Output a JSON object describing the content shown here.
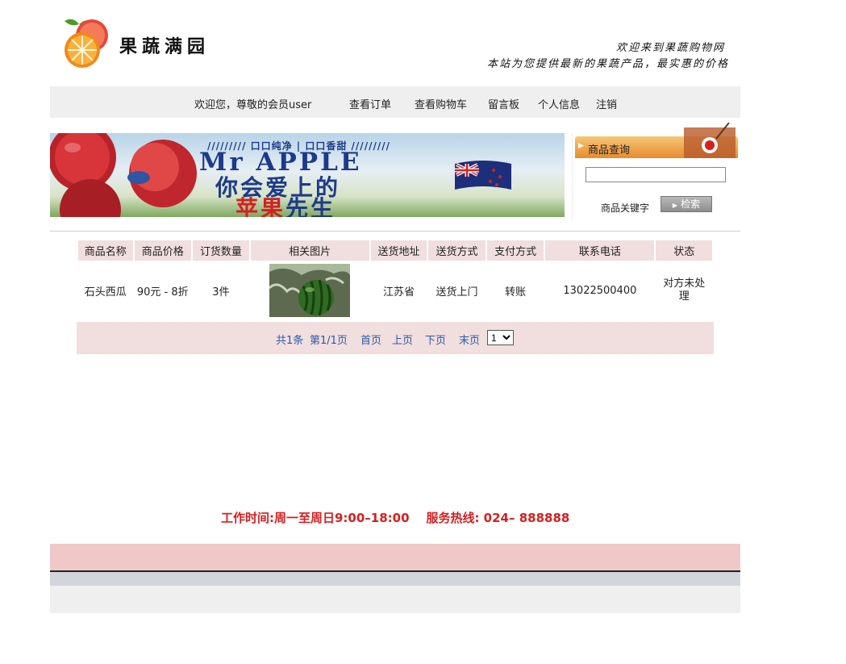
{
  "header": {
    "logo_text": "果蔬满园",
    "welcome_title": "欢迎来到果蔬购物网",
    "welcome_sub": "本站为您提供最新的果蔬产品，最实惠的价格"
  },
  "nav": {
    "greeting": "欢迎您，尊敬的会员user",
    "items": [
      "查看订单",
      "查看购物车",
      "留言板",
      "个人信息",
      "注销"
    ]
  },
  "banner": {
    "tag": "///////// 口口纯净 | 口口香甜 /////////",
    "title": "Mr APPLE",
    "line2": "你会爱上的",
    "line3_red": "苹果",
    "line3_blue": "先生"
  },
  "search": {
    "header": "商品查询",
    "input_value": "",
    "label": "商品关键字",
    "button": "检索"
  },
  "table": {
    "columns": [
      "商品名称",
      "商品价格",
      "订货数量",
      "相关图片",
      "送货地址",
      "送货方式",
      "支付方式",
      "联系电话",
      "状态"
    ],
    "rows": [
      {
        "name": "石头西瓜",
        "price": "90元 - 8折",
        "quantity": "3件",
        "image": "watermelon-photo",
        "address": "江苏省",
        "delivery": "送货上门",
        "payment": "转账",
        "phone": "13022500400",
        "status": "对方未处理"
      }
    ]
  },
  "pager": {
    "total": "共1条",
    "page": "第1/1页",
    "first": "首页",
    "prev": "上页",
    "next": "下页",
    "last": "末页",
    "select_value": "1"
  },
  "footer": {
    "hours": "工作时间:周一至周日9:00–18:00    服务热线: 024– 888888"
  },
  "colors": {
    "nav_bg": "#efefef",
    "table_header_bg": "#f1dede",
    "link": "#2b5aa8",
    "hotline": "#d42020",
    "footer_pink": "#f0c8c8"
  }
}
